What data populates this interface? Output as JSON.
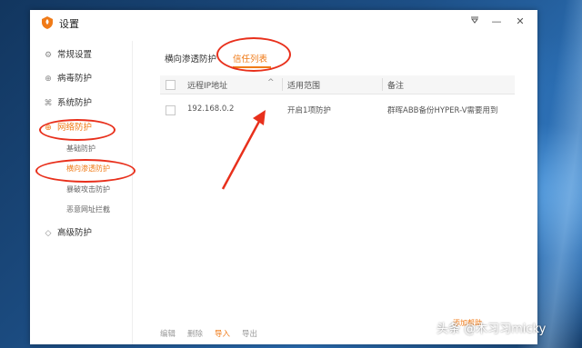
{
  "window": {
    "title": "设置"
  },
  "sidebar": {
    "items": [
      {
        "label": "常规设置",
        "icon": "gear-icon"
      },
      {
        "label": "病毒防护",
        "icon": "plus-circle-icon"
      },
      {
        "label": "系统防护",
        "icon": "system-icon"
      },
      {
        "label": "网络防护",
        "icon": "globe-icon"
      },
      {
        "label": "高级防护",
        "icon": "diamond-icon"
      }
    ],
    "subitems": [
      {
        "label": "基础防护"
      },
      {
        "label": "横向渗透防护"
      },
      {
        "label": "暴破攻击防护"
      },
      {
        "label": "恶意网址拦截"
      }
    ]
  },
  "tabs": [
    {
      "label": "横向渗透防护"
    },
    {
      "label": "信任列表"
    }
  ],
  "table": {
    "columns": [
      "远程IP地址",
      "适用范围",
      "备注"
    ],
    "rows": [
      {
        "ip": "192.168.0.2",
        "scope": "开启1项防护",
        "note": "群晖ABB备份HYPER-V需要用到"
      }
    ]
  },
  "footer": {
    "edit": "编辑",
    "delete": "删除",
    "import": "导入",
    "export": "导出",
    "help": "添加帮助"
  },
  "watermark": "头条 @木习习micky",
  "colors": {
    "accent": "#f07b18",
    "annotation": "#e8301c"
  }
}
